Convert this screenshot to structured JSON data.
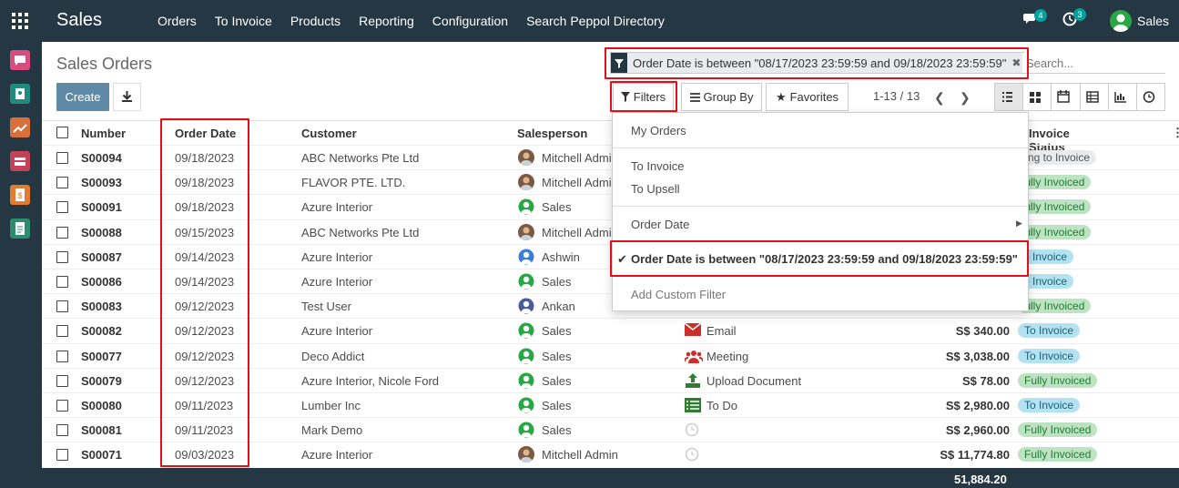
{
  "topbar": {
    "brand": "Sales",
    "menu": [
      "Orders",
      "To Invoice",
      "Products",
      "Reporting",
      "Configuration",
      "Search Peppol Directory"
    ],
    "chat_count": "4",
    "activity_count": "3",
    "user_name": "Sales"
  },
  "control_panel": {
    "title": "Sales Orders",
    "create_label": "Create",
    "facet_label": "Order Date is between \"08/17/2023 23:59:59 and 09/18/2023 23:59:59\"",
    "search_placeholder": "Search...",
    "filters_label": "Filters",
    "group_by_label": "Group By",
    "favorites_label": "Favorites",
    "pager": "1-13 / 13"
  },
  "table": {
    "headers": [
      "Number",
      "Order Date",
      "Customer",
      "Salesperson",
      "Invoice Status"
    ],
    "rows": [
      {
        "number": "S00094",
        "date": "09/18/2023",
        "customer": "ABC Networks Pte Ltd",
        "salesperson": "Mitchell Admin",
        "status": "Nothing to Invoice"
      },
      {
        "number": "S00093",
        "date": "09/18/2023",
        "customer": "FLAVOR PTE. LTD.",
        "salesperson": "Mitchell Admin",
        "status": "Fully Invoiced"
      },
      {
        "number": "S00091",
        "date": "09/18/2023",
        "customer": "Azure Interior",
        "salesperson": "Sales",
        "status": "Fully Invoiced"
      },
      {
        "number": "S00088",
        "date": "09/15/2023",
        "customer": "ABC Networks Pte Ltd",
        "salesperson": "Mitchell Admin",
        "status": "Fully Invoiced"
      },
      {
        "number": "S00087",
        "date": "09/14/2023",
        "customer": "Azure Interior",
        "salesperson": "Ashwin",
        "status": "To Invoice"
      },
      {
        "number": "S00086",
        "date": "09/14/2023",
        "customer": "Azure Interior",
        "salesperson": "Sales",
        "status": "To Invoice"
      },
      {
        "number": "S00083",
        "date": "09/12/2023",
        "customer": "Test User",
        "salesperson": "Ankan",
        "status": "Fully Invoiced"
      },
      {
        "number": "S00082",
        "date": "09/12/2023",
        "customer": "Azure Interior",
        "salesperson": "Sales",
        "activity": "Email",
        "total": "S$ 340.00",
        "status": "To Invoice"
      },
      {
        "number": "S00077",
        "date": "09/12/2023",
        "customer": "Deco Addict",
        "salesperson": "Sales",
        "activity": "Meeting",
        "total": "S$ 3,038.00",
        "status": "To Invoice"
      },
      {
        "number": "S00079",
        "date": "09/12/2023",
        "customer": "Azure Interior, Nicole Ford",
        "salesperson": "Sales",
        "activity": "Upload Document",
        "total": "S$ 78.00",
        "status": "Fully Invoiced"
      },
      {
        "number": "S00080",
        "date": "09/11/2023",
        "customer": "Lumber Inc",
        "salesperson": "Sales",
        "activity": "To Do",
        "total": "S$ 2,980.00",
        "status": "To Invoice"
      },
      {
        "number": "S00081",
        "date": "09/11/2023",
        "customer": "Mark Demo",
        "salesperson": "Sales",
        "activity": "",
        "total": "S$ 2,960.00",
        "status": "Fully Invoiced"
      },
      {
        "number": "S00071",
        "date": "09/03/2023",
        "customer": "Azure Interior",
        "salesperson": "Mitchell Admin",
        "activity": "",
        "total": "S$ 11,774.80",
        "status": "Fully Invoiced"
      }
    ],
    "footer_total": "51,884.20"
  },
  "filters_dropdown": {
    "my_orders": "My Orders",
    "to_invoice": "To Invoice",
    "to_upsell": "To Upsell",
    "order_date": "Order Date",
    "active_filter": "Order Date is between \"08/17/2023 23:59:59 and 09/18/2023 23:59:59\"",
    "add_custom": "Add Custom Filter"
  },
  "colors": {
    "navbar": "#243742",
    "primary_button": "#5f8aa7",
    "highlight_box": "#e10f17",
    "fully_invoiced_bg": "#bde3c3",
    "to_invoice_bg": "#b4e2f0"
  }
}
